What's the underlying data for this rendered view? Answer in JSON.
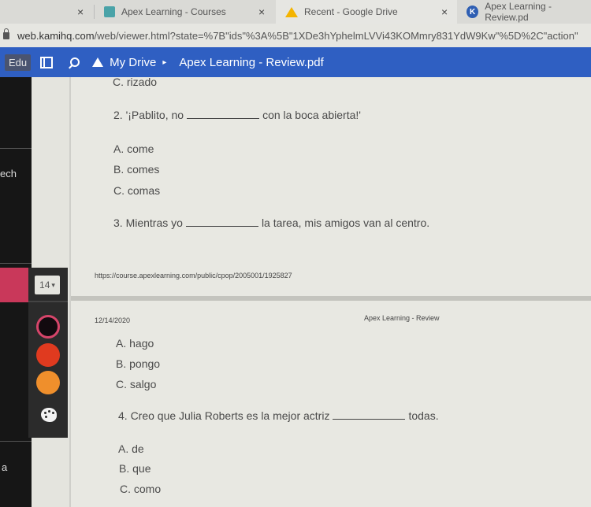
{
  "browser": {
    "tabs": [
      {
        "title": "",
        "close": "×"
      },
      {
        "title": "Apex Learning - Courses",
        "icon": "apex-courses-favicon",
        "close": "×"
      },
      {
        "title": "Recent - Google Drive",
        "icon": "google-drive-favicon",
        "close": "×"
      },
      {
        "title": "Apex Learning - Review.pd",
        "icon": "kami-favicon"
      }
    ],
    "url_host": "web.kamihq.com",
    "url_path": "/web/viewer.html?state=%7B\"ids\"%3A%5B\"1XDe3hYphelmLVVi43KOMmry831YdW9Kw\"%5D%2C\"action\""
  },
  "kami_toolbar": {
    "edu_badge": "Edu",
    "breadcrumb_root": "My Drive",
    "breadcrumb_arrow": "▸",
    "document_title": "Apex Learning - Review.pdf"
  },
  "left_sidebar": {
    "partial_labels": [
      "ech",
      "a"
    ]
  },
  "tool_palette": {
    "font_size": "14",
    "font_size_caret": "▾",
    "colors": [
      "#120a0f",
      "#e03a1f",
      "#ef8f2c"
    ],
    "selected_color": "#120a0f"
  },
  "document": {
    "prev_option": "C. rizado",
    "questions": [
      {
        "before": "2. '¡Pablito, no",
        "after": "con la boca abierta!'",
        "options": [
          "A. come",
          "B. comes",
          "C. comas"
        ]
      },
      {
        "before": "3. Mientras yo",
        "after": "la tarea, mis amigos van al centro.",
        "options": [
          "A. hago",
          "B. pongo",
          "C. salgo"
        ]
      },
      {
        "before": "4. Creo que Julia Roberts es la mejor actriz",
        "after": "todas.",
        "options": [
          "A. de",
          "B. que",
          "C. como"
        ]
      }
    ],
    "page_footer_url": "https://course.apexlearning.com/public/cpop/2005001/1925827",
    "page_header_date": "12/14/2020",
    "page_header_title": "Apex Learning - Review"
  }
}
